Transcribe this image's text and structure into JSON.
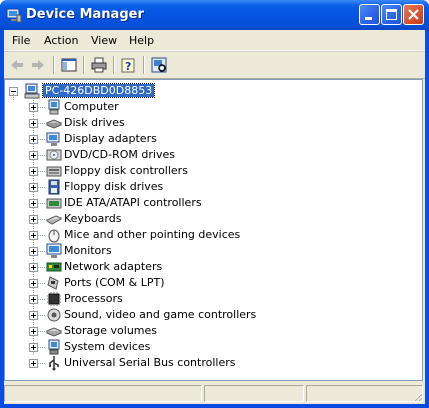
{
  "window": {
    "title": "Device Manager"
  },
  "menu": {
    "file": "File",
    "action": "Action",
    "view": "View",
    "help": "Help"
  },
  "tree": {
    "root": "PC-426DBD0D8853",
    "items": [
      {
        "label": "Computer",
        "icon": "computer-icon"
      },
      {
        "label": "Disk drives",
        "icon": "disk-drive-icon"
      },
      {
        "label": "Display adapters",
        "icon": "display-adapter-icon"
      },
      {
        "label": "DVD/CD-ROM drives",
        "icon": "cd-drive-icon"
      },
      {
        "label": "Floppy disk controllers",
        "icon": "floppy-controller-icon"
      },
      {
        "label": "Floppy disk drives",
        "icon": "floppy-drive-icon"
      },
      {
        "label": "IDE ATA/ATAPI controllers",
        "icon": "ide-controller-icon"
      },
      {
        "label": "Keyboards",
        "icon": "keyboard-icon"
      },
      {
        "label": "Mice and other pointing devices",
        "icon": "mouse-icon"
      },
      {
        "label": "Monitors",
        "icon": "monitor-icon"
      },
      {
        "label": "Network adapters",
        "icon": "network-adapter-icon"
      },
      {
        "label": "Ports (COM & LPT)",
        "icon": "port-icon"
      },
      {
        "label": "Processors",
        "icon": "processor-icon"
      },
      {
        "label": "Sound, video and game controllers",
        "icon": "sound-icon"
      },
      {
        "label": "Storage volumes",
        "icon": "storage-volume-icon"
      },
      {
        "label": "System devices",
        "icon": "system-device-icon"
      },
      {
        "label": "Universal Serial Bus controllers",
        "icon": "usb-icon"
      }
    ]
  },
  "colors": {
    "titlebar": "#0554e3",
    "selection": "#316ac5",
    "close": "#d8502c"
  }
}
